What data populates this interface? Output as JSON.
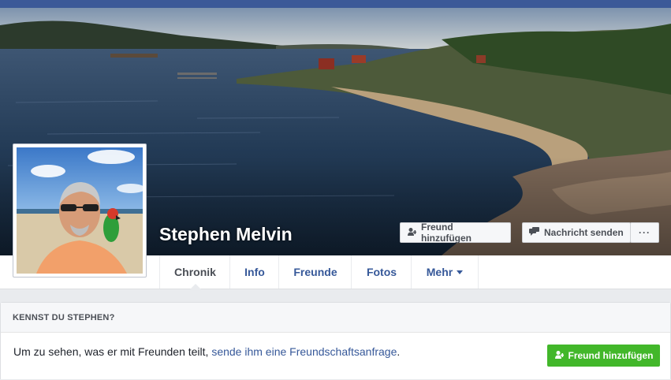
{
  "profile": {
    "name": "Stephen Melvin"
  },
  "actions": {
    "add_friend": "Freund hinzufügen",
    "send_message": "Nachricht senden",
    "more_dots": "···"
  },
  "nav": {
    "tabs": [
      {
        "label": "Chronik"
      },
      {
        "label": "Info"
      },
      {
        "label": "Freunde"
      },
      {
        "label": "Fotos"
      },
      {
        "label": "Mehr"
      }
    ]
  },
  "card": {
    "header": "KENNST DU STEPHEN?",
    "text_before": "Um zu sehen, was er mit Freunden teilt, ",
    "link": "sende ihm eine Freundschaftsanfrage",
    "text_after": ".",
    "button": "Freund hinzufügen"
  },
  "colors": {
    "brand": "#3b5998",
    "link": "#365899",
    "green": "#42b72a"
  }
}
